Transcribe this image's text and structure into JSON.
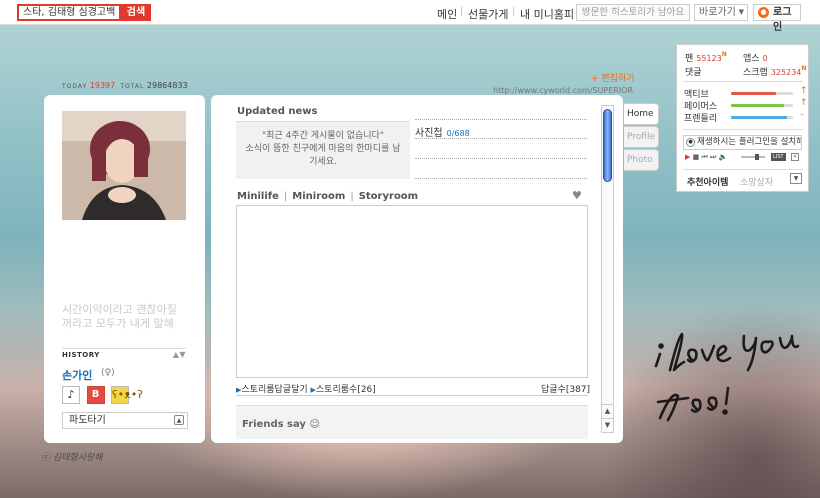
{
  "topbar": {
    "search_value": "스타, 김태형 심경고백",
    "search_button": "검색",
    "nav_main": "메인",
    "nav_gift": "선물가게",
    "nav_myhome": "내 미니홈피",
    "history_text": "방문한 히스토리가 남아요",
    "goto_label": "바로가기",
    "login_label": "로그인"
  },
  "counter": {
    "today_label": "TODAY",
    "today_value": "19397",
    "total_label": "TOTAL",
    "total_value": "29864833"
  },
  "edit_link": "+ 편집하기",
  "home_url": "http://www.cyworld.com/SUPERIOR",
  "left": {
    "profile_text": "시간이약이라고 괜찮아질꺼라고 모두가 내게 말해",
    "history_label": "HISTORY",
    "owner_name": "손가인",
    "wave_select": "파도타기"
  },
  "main": {
    "updated_news_title": "Updated news",
    "news_notice": "\"최근 4주간 게시물이 없습니다\"",
    "news_sub": "소식이 뜸한 친구에게 마음의 한마디를 남기세요.",
    "photo_album_label": "사진첩",
    "photo_album_count": "0/688",
    "tab_minilife": "Minilife",
    "tab_miniroom": "Miniroom",
    "tab_storyroom": "Storyroom",
    "story_reply_link": "스토리룸답글달기",
    "story_count_link": "스토리룸수",
    "story_count": "[26]",
    "reply_count_label": "답글수",
    "reply_count": "[387]",
    "friends_say": "Friends say"
  },
  "side_tabs": [
    "Home",
    "Profile",
    "Photo"
  ],
  "widget": {
    "fan_label": "팬",
    "fan_value": "55123",
    "app_label": "앱스",
    "app_value": "0",
    "comment_label": "댓글",
    "scrap_label": "스크랩",
    "scrap_value": "325234",
    "new_mark": "N",
    "meters": [
      {
        "label": "액티브",
        "level": 0.72,
        "color": "#e6574a"
      },
      {
        "label": "페이머스",
        "level": 0.85,
        "color": "#7cc441"
      },
      {
        "label": "프렌들리",
        "level": 0.9,
        "color": "#4aaedd"
      }
    ],
    "plugin_text": "재생하시는 플러그인을 설치해 주세요 (설치)",
    "player_list": "LIST",
    "rec_item": "추천아이템",
    "rec_seller": "소망상자"
  },
  "signature": "ⓒ 김태형사랑해"
}
